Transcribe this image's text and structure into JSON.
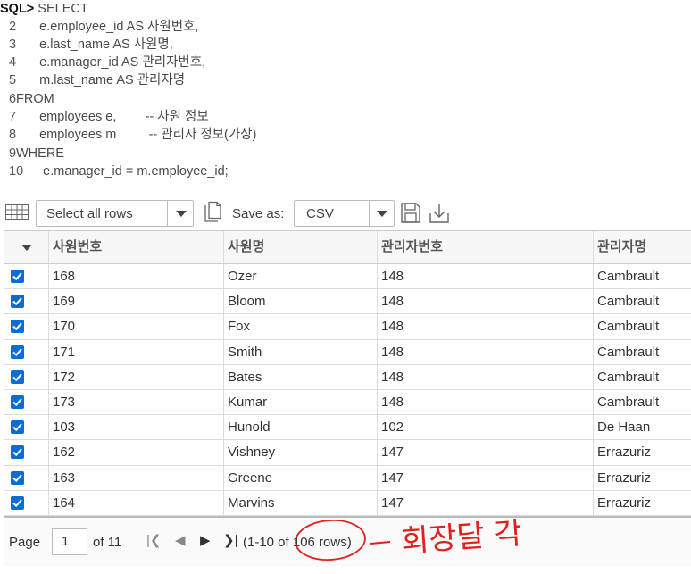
{
  "sql": {
    "prompt": "SQL>",
    "lines": [
      {
        "num": "",
        "code": " SELECT"
      },
      {
        "num": "2",
        "code": "    e.employee_id AS 사원번호,"
      },
      {
        "num": "3",
        "code": "    e.last_name AS 사원명,"
      },
      {
        "num": "4",
        "code": "    e.manager_id AS 관리자번호,"
      },
      {
        "num": "5",
        "code": "    m.last_name AS 관리자명"
      },
      {
        "num": "6",
        "code": "FROM"
      },
      {
        "num": "7",
        "code": "    employees e,        -- 사원 정보"
      },
      {
        "num": "8",
        "code": "    employees m         -- 관리자 정보(가상)"
      },
      {
        "num": "9",
        "code": "WHERE"
      },
      {
        "num": "10",
        "code": "     e.manager_id = m.employee_id;"
      }
    ]
  },
  "toolbar": {
    "select_rows": "Select all rows",
    "save_as": "Save as:",
    "format": "CSV"
  },
  "table": {
    "columns": [
      "사원번호",
      "사원명",
      "관리자번호",
      "관리자명"
    ],
    "rows": [
      [
        "168",
        "Ozer",
        "148",
        "Cambrault"
      ],
      [
        "169",
        "Bloom",
        "148",
        "Cambrault"
      ],
      [
        "170",
        "Fox",
        "148",
        "Cambrault"
      ],
      [
        "171",
        "Smith",
        "148",
        "Cambrault"
      ],
      [
        "172",
        "Bates",
        "148",
        "Cambrault"
      ],
      [
        "173",
        "Kumar",
        "148",
        "Cambrault"
      ],
      [
        "103",
        "Hunold",
        "102",
        "De Haan"
      ],
      [
        "162",
        "Vishney",
        "147",
        "Errazuriz"
      ],
      [
        "163",
        "Greene",
        "147",
        "Errazuriz"
      ],
      [
        "164",
        "Marvins",
        "147",
        "Errazuriz"
      ]
    ]
  },
  "pagination": {
    "page_label": "Page",
    "page_value": "1",
    "of_label": "of 11",
    "range_text": "(1-10 of 106 rows)"
  },
  "annotation": {
    "text": "회장달 각",
    "color": "#e0201a"
  },
  "colors": {
    "checkbox": "#0a6cd6"
  }
}
